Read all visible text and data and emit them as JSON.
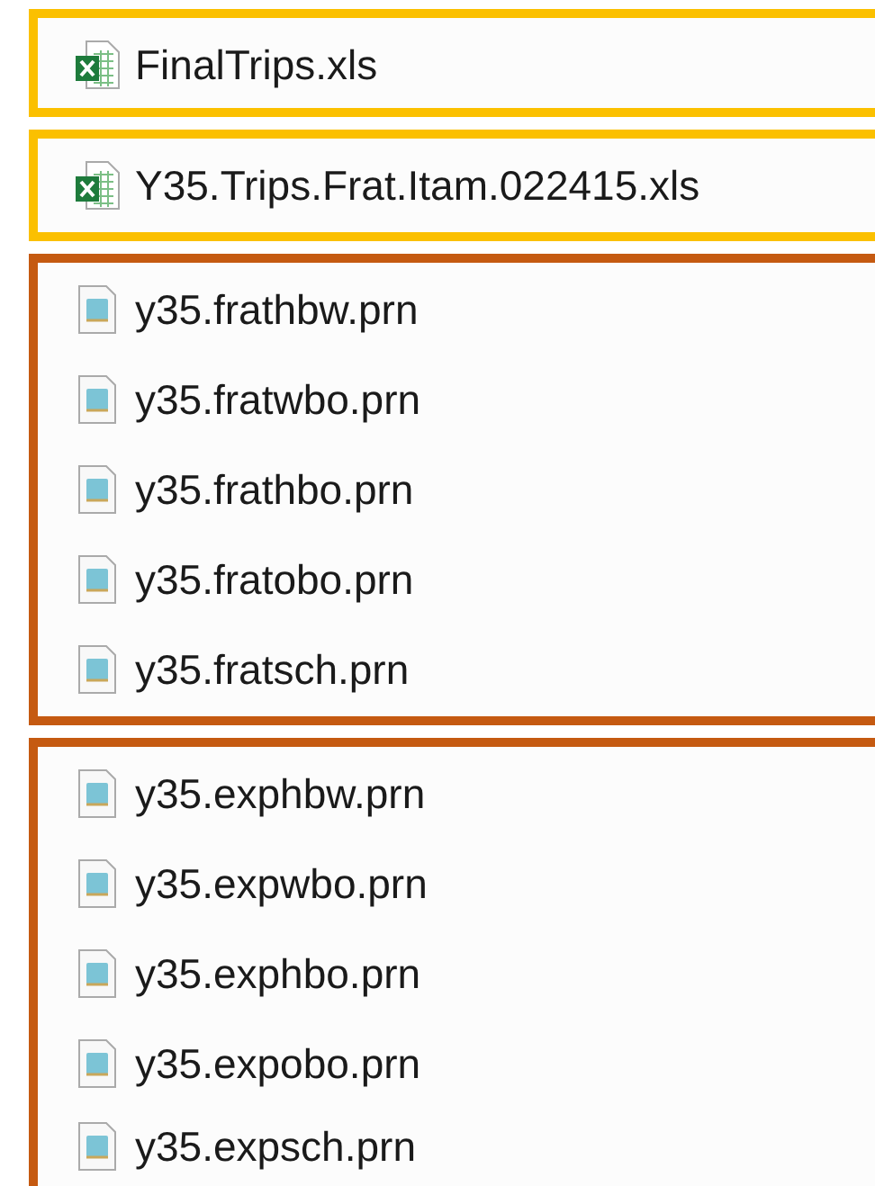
{
  "groups": [
    {
      "color": "#fbc000",
      "files": [
        {
          "kind": "xls",
          "name": "FinalTrips.xls"
        }
      ]
    },
    {
      "color": "#fbc000",
      "files": [
        {
          "kind": "xls",
          "name": "Y35.Trips.Frat.Itam.022415.xls"
        }
      ]
    },
    {
      "color": "#c55a11",
      "files": [
        {
          "kind": "prn",
          "name": "y35.frathbw.prn"
        },
        {
          "kind": "prn",
          "name": "y35.fratwbo.prn"
        },
        {
          "kind": "prn",
          "name": "y35.frathbo.prn"
        },
        {
          "kind": "prn",
          "name": "y35.fratobo.prn"
        },
        {
          "kind": "prn",
          "name": "y35.fratsch.prn"
        }
      ]
    },
    {
      "color": "#c55a11",
      "files": [
        {
          "kind": "prn",
          "name": "y35.exphbw.prn"
        },
        {
          "kind": "prn",
          "name": "y35.expwbo.prn"
        },
        {
          "kind": "prn",
          "name": "y35.exphbo.prn"
        },
        {
          "kind": "prn",
          "name": "y35.expobo.prn"
        },
        {
          "kind": "prn",
          "name": "y35.expsch.prn"
        }
      ]
    }
  ]
}
